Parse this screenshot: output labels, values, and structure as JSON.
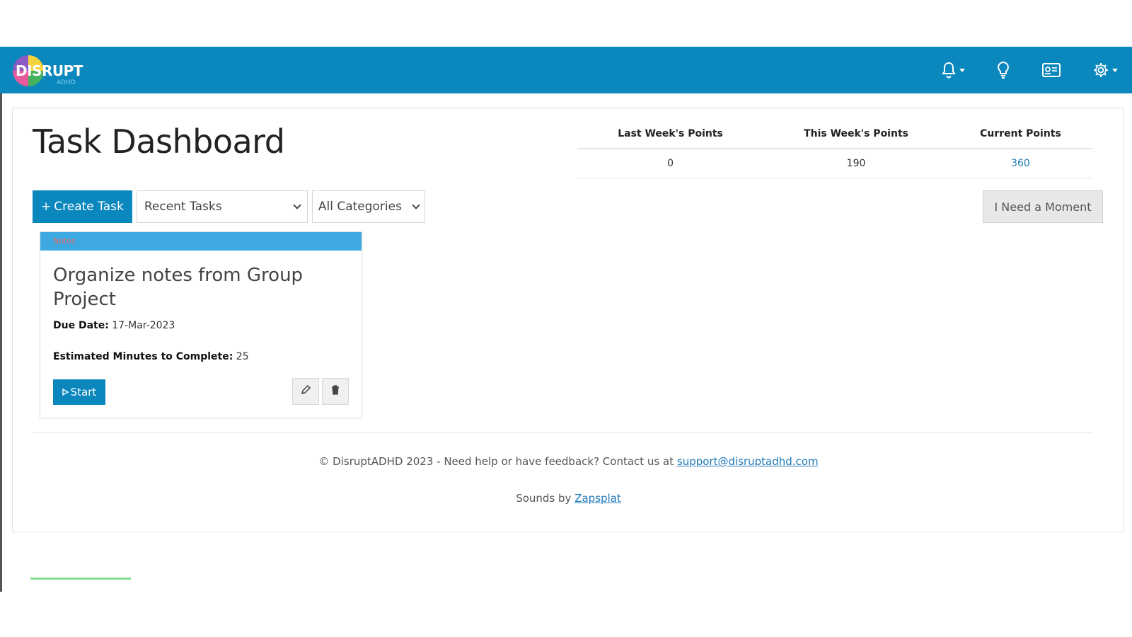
{
  "brand": {
    "name": "DISRUPT",
    "sub": "ADHD"
  },
  "nav": {
    "icons": [
      "bell-icon",
      "lightbulb-icon",
      "id-card-icon",
      "gear-icon"
    ]
  },
  "page": {
    "title": "Task Dashboard"
  },
  "points": {
    "headers": [
      "Last Week's Points",
      "This Week's Points",
      "Current Points"
    ],
    "values": [
      "0",
      "190",
      "360"
    ]
  },
  "toolbar": {
    "create_label": "Create Task",
    "create_prefix": "+",
    "filter_value": "Recent Tasks",
    "category_value": "All Categories",
    "moment_label": "I Need a Moment"
  },
  "task": {
    "category": "Notes",
    "title": "Organize notes from Group Project",
    "due_label": "Due Date:",
    "due_value": "17-Mar-2023",
    "minutes_label": "Estimated Minutes to Complete:",
    "minutes_value": "25",
    "start_label": "Start"
  },
  "footer": {
    "copyright_text": "© DisruptADHD 2023 - Need help or have feedback? Contact us at",
    "support_email": "support@disruptadhd.com",
    "sounds_text": "Sounds by",
    "sounds_link": "Zapsplat"
  },
  "colors": {
    "primary": "#0a87bd",
    "category_bar": "#3ea9e0",
    "link": "#1e78b6"
  }
}
